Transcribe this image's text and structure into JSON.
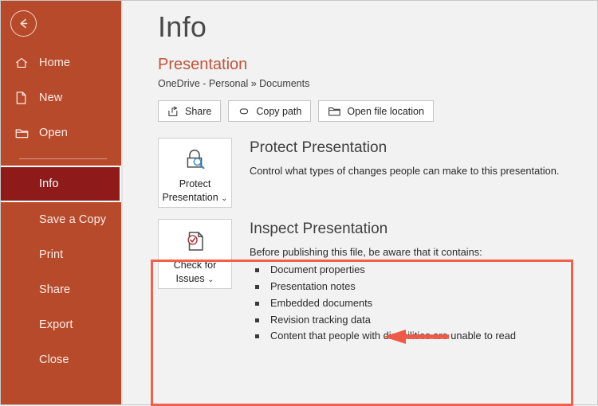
{
  "app": {
    "accent_orange": "#b84a2c",
    "accent_selected": "#8e1b19",
    "highlight_red": "#f2604b",
    "doc_name_color": "#c0543a"
  },
  "sidebar": {
    "back_button": {
      "name": "back-button",
      "icon": "arrow-left-circle-icon"
    },
    "items": [
      {
        "label": "Home",
        "icon": "home-icon",
        "selected": false,
        "has_icon": true
      },
      {
        "label": "New",
        "icon": "file-icon",
        "selected": false,
        "has_icon": true
      },
      {
        "label": "Open",
        "icon": "folder-icon",
        "selected": false,
        "has_icon": true
      },
      {
        "label": "Info",
        "icon": "",
        "selected": true,
        "has_icon": false
      },
      {
        "label": "Save a Copy",
        "icon": "",
        "selected": false,
        "has_icon": false
      },
      {
        "label": "Print",
        "icon": "",
        "selected": false,
        "has_icon": false
      },
      {
        "label": "Share",
        "icon": "",
        "selected": false,
        "has_icon": false
      },
      {
        "label": "Export",
        "icon": "",
        "selected": false,
        "has_icon": false
      },
      {
        "label": "Close",
        "icon": "",
        "selected": false,
        "has_icon": false
      }
    ]
  },
  "main": {
    "page_title": "Info",
    "document": {
      "name": "Presentation",
      "path": "OneDrive - Personal » Documents"
    },
    "commands": [
      {
        "label": "Share",
        "icon": "share-icon"
      },
      {
        "label": "Copy path",
        "icon": "link-icon"
      },
      {
        "label": "Open file location",
        "icon": "folder-open-icon"
      }
    ],
    "protect_section": {
      "button_label_line1": "Protect",
      "button_label_line2": "Presentation",
      "button_chevron": "⌄",
      "button_icon": "lock-magnifier-icon",
      "title": "Protect Presentation",
      "description": "Control what types of changes people can make to this presentation."
    },
    "inspect_section": {
      "button_label_line1": "Check for",
      "button_label_line2": "Issues",
      "button_chevron": "⌄",
      "button_icon": "document-check-icon",
      "title": "Inspect Presentation",
      "description": "Before publishing this file, be aware that it contains:",
      "bullets": [
        "Document properties",
        "Presentation notes",
        "Embedded documents",
        "Revision tracking data",
        "Content that people with disabilities are unable to read"
      ]
    }
  },
  "annotations": {
    "highlight_box": {
      "target": "inspect-presentation-section"
    },
    "arrow": {
      "points_to": "Presentation notes",
      "direction": "left"
    }
  }
}
